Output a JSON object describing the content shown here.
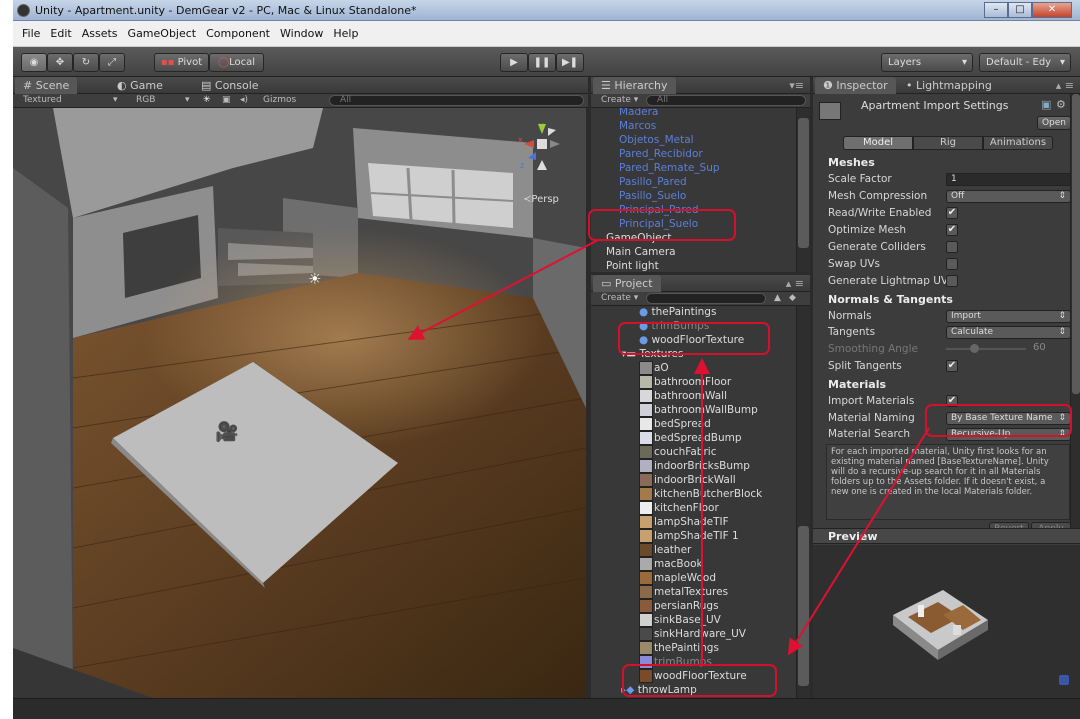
{
  "window": {
    "title": "Unity - Apartment.unity - DemGear v2 - PC, Mac & Linux Standalone*"
  },
  "menu": [
    "File",
    "Edit",
    "Assets",
    "GameObject",
    "Component",
    "Window",
    "Help"
  ],
  "toolbar": {
    "pivot": "Pivot",
    "local": "Local",
    "layers": "Layers",
    "layout": "Default - Edy"
  },
  "scene": {
    "tabs": [
      "Scene",
      "Game",
      "Console"
    ],
    "render_mode": "Textured",
    "color_mode": "RGB",
    "gizmos": "Gizmos",
    "search": "All",
    "persp": "Persp"
  },
  "hierarchy": {
    "tab": "Hierarchy",
    "create": "Create",
    "search": "All",
    "items": [
      {
        "label": "Madera",
        "color": "blue"
      },
      {
        "label": "Marcos",
        "color": "blue"
      },
      {
        "label": "Objetos_Metal",
        "color": "blue"
      },
      {
        "label": "Pared_Recibidor",
        "color": "blue"
      },
      {
        "label": "Pared_Remate_Sup",
        "color": "blue"
      },
      {
        "label": "Pasillo_Pared",
        "color": "blue"
      },
      {
        "label": "Pasillo_Suelo",
        "color": "blue"
      },
      {
        "label": "Principal_Pared",
        "color": "blue"
      },
      {
        "label": "Principal_Suelo",
        "color": "blue"
      },
      {
        "label": "GameObject",
        "color": "grey"
      },
      {
        "label": "Main Camera",
        "color": "grey"
      },
      {
        "label": "Point light",
        "color": "grey"
      }
    ]
  },
  "project": {
    "tab": "Project",
    "create": "Create",
    "materials": [
      "thePaintings",
      "trimBumps",
      "woodFloorTexture"
    ],
    "folder": "Textures",
    "textures": [
      {
        "label": "aO",
        "color": "#8a8a8a"
      },
      {
        "label": "bathroomFloor",
        "color": "#b8b8a8"
      },
      {
        "label": "bathroomWall",
        "color": "#d8d8d8"
      },
      {
        "label": "bathroomWallBump",
        "color": "#d0d0d8"
      },
      {
        "label": "bedSpread",
        "color": "#e8e8e8"
      },
      {
        "label": "bedSpreadBump",
        "color": "#dcdce8"
      },
      {
        "label": "couchFabric",
        "color": "#6a6a5a"
      },
      {
        "label": "indoorBricksBump",
        "color": "#b0b0c0"
      },
      {
        "label": "indoorBrickWall",
        "color": "#8c6a5a"
      },
      {
        "label": "kitchenButcherBlock",
        "color": "#a57a4a"
      },
      {
        "label": "kitchenFloor",
        "color": "#ededed"
      },
      {
        "label": "lampShadeTIF",
        "color": "#c8a070"
      },
      {
        "label": "lampShadeTIF 1",
        "color": "#c8a070"
      },
      {
        "label": "leather",
        "color": "#6a4a2a"
      },
      {
        "label": "macBook",
        "color": "#aaaaaa"
      },
      {
        "label": "mapleWood",
        "color": "#9a6a3a"
      },
      {
        "label": "metalTextures",
        "color": "#8a6a4a"
      },
      {
        "label": "persianRugs",
        "color": "#8a5a3a"
      },
      {
        "label": "sinkBase_UV",
        "color": "#d0d0d0"
      },
      {
        "label": "sinkHardware_UV",
        "color": "#4a4a4a"
      },
      {
        "label": "thePaintings",
        "color": "#9a8a6a"
      },
      {
        "label": "trimBumps",
        "color": "#8a8ad8"
      },
      {
        "label": "woodFloorTexture",
        "color": "#7a4a2a"
      }
    ],
    "last_item": "throwLamp"
  },
  "inspector": {
    "tabs": [
      "Inspector",
      "Lightmapping"
    ],
    "title": "Apartment Import Settings",
    "open": "Open",
    "subtabs": [
      "Model",
      "Rig",
      "Animations"
    ],
    "meshes": "Meshes",
    "scale_factor_label": "Scale Factor",
    "scale_factor": "1",
    "mesh_compression_label": "Mesh Compression",
    "mesh_compression": "Off",
    "read_write_label": "Read/Write Enabled",
    "optimize_label": "Optimize Mesh",
    "colliders_label": "Generate Colliders",
    "swap_label": "Swap UVs",
    "lightmap_label": "Generate Lightmap UV:",
    "normals_section": "Normals & Tangents",
    "normals_label": "Normals",
    "normals": "Import",
    "tangents_label": "Tangents",
    "tangents": "Calculate",
    "smoothing_label": "Smoothing Angle",
    "smoothing": "60",
    "split_label": "Split Tangents",
    "materials_section": "Materials",
    "import_materials_label": "Import Materials",
    "naming_label": "Material Naming",
    "naming": "By Base Texture Name",
    "search_label": "Material Search",
    "search": "Recursive-Up",
    "help": "For each imported material, Unity first looks for an existing material named [BaseTextureName]. Unity will do a recursive-up search for it in all Materials folders up to the Assets folder. If it doesn't exist, a new one is created in the local Materials folder.",
    "revert": "Revert",
    "apply": "Apply",
    "preview": "Preview"
  }
}
